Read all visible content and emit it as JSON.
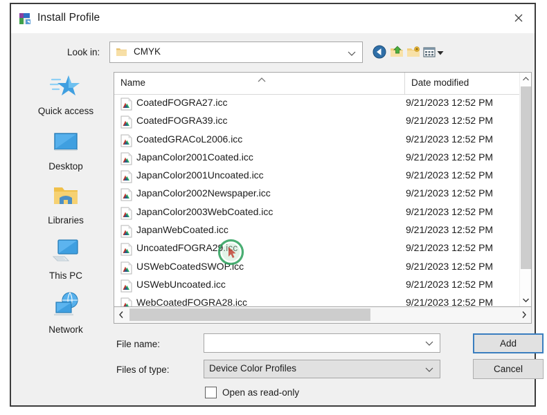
{
  "window": {
    "title": "Install Profile",
    "icon": "install-profile-icon",
    "close_label": "×"
  },
  "lookin": {
    "label": "Look in:",
    "value": "CMYK",
    "icon": "folder-icon",
    "caret": "chevron-down-icon"
  },
  "toolbar": {
    "items": [
      {
        "name": "back-button",
        "icon": "back-arrow-icon"
      },
      {
        "name": "up-one-level-button",
        "icon": "up-folder-icon"
      },
      {
        "name": "new-folder-button",
        "icon": "new-folder-icon"
      },
      {
        "name": "views-button",
        "icon": "views-icon"
      },
      {
        "name": "views-dropdown",
        "icon": "caret-down-icon"
      }
    ]
  },
  "places": [
    {
      "label": "Quick access",
      "icon": "quick-access-star-icon"
    },
    {
      "label": "Desktop",
      "icon": "desktop-monitor-icon"
    },
    {
      "label": "Libraries",
      "icon": "libraries-folder-icon"
    },
    {
      "label": "This PC",
      "icon": "this-pc-icon"
    },
    {
      "label": "Network",
      "icon": "network-globe-icon"
    }
  ],
  "filelist": {
    "columns": [
      "Name",
      "Date modified"
    ],
    "sort_indicator": "sort-ascending-chevron",
    "rows": [
      {
        "name": "CoatedFOGRA27.icc",
        "date": "9/21/2023 12:52 PM"
      },
      {
        "name": "CoatedFOGRA39.icc",
        "date": "9/21/2023 12:52 PM"
      },
      {
        "name": "CoatedGRACoL2006.icc",
        "date": "9/21/2023 12:52 PM"
      },
      {
        "name": "JapanColor2001Coated.icc",
        "date": "9/21/2023 12:52 PM"
      },
      {
        "name": "JapanColor2001Uncoated.icc",
        "date": "9/21/2023 12:52 PM"
      },
      {
        "name": "JapanColor2002Newspaper.icc",
        "date": "9/21/2023 12:52 PM"
      },
      {
        "name": "JapanColor2003WebCoated.icc",
        "date": "9/21/2023 12:52 PM"
      },
      {
        "name": "JapanWebCoated.icc",
        "date": "9/21/2023 12:52 PM"
      },
      {
        "name": "UncoatedFOGRA29.icc",
        "date": "9/21/2023 12:52 PM"
      },
      {
        "name": "USWebCoatedSWOP.icc",
        "date": "9/21/2023 12:52 PM"
      },
      {
        "name": "USWebUncoated.icc",
        "date": "9/21/2023 12:52 PM"
      },
      {
        "name": "WebCoatedFOGRA28.icc",
        "date": "9/21/2023 12:52 PM"
      }
    ]
  },
  "form": {
    "filename_label": "File name:",
    "filename_value": "",
    "filename_placeholder": "",
    "filetype_label": "Files of type:",
    "filetype_value": "Device Color Profiles",
    "readonly_label": "Open as read-only",
    "readonly_checked": false
  },
  "buttons": {
    "add": "Add",
    "cancel": "Cancel"
  },
  "colors": {
    "focus_border": "#3a7ebf",
    "dialog_border": "#3c3c3c",
    "dialog_bg": "#f0f0f0",
    "scroll_thumb": "#cdcdcd",
    "click_marker": "#2aa05a"
  }
}
